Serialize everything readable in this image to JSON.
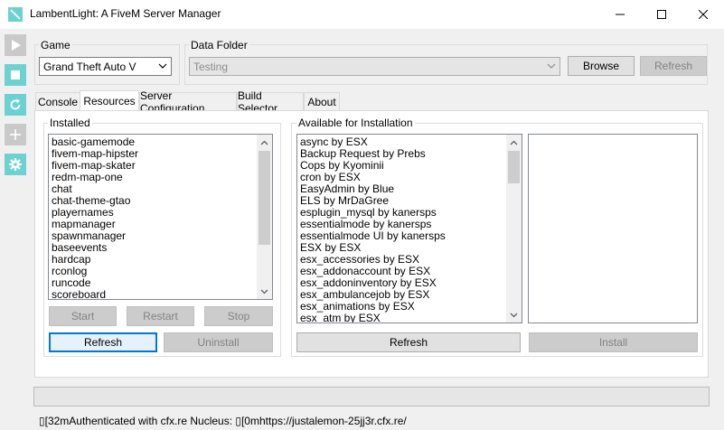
{
  "window": {
    "title": "LambentLight: A FiveM Server Manager",
    "accent": "#6ed1d1"
  },
  "game": {
    "label": "Game",
    "selected": "Grand Theft Auto V"
  },
  "data_folder": {
    "label": "Data Folder",
    "selected": "Testing",
    "browse_label": "Browse",
    "refresh_label": "Refresh"
  },
  "tabs": [
    {
      "label": "Console"
    },
    {
      "label": "Resources"
    },
    {
      "label": "Server Configuration"
    },
    {
      "label": "Build Selector"
    },
    {
      "label": "About"
    }
  ],
  "installed": {
    "label": "Installed",
    "items": [
      "basic-gamemode",
      "fivem-map-hipster",
      "fivem-map-skater",
      "redm-map-one",
      "chat",
      "chat-theme-gtao",
      "playernames",
      "mapmanager",
      "spawnmanager",
      "baseevents",
      "hardcap",
      "rconlog",
      "runcode",
      "scoreboard"
    ],
    "start_label": "Start",
    "restart_label": "Restart",
    "stop_label": "Stop",
    "refresh_label": "Refresh",
    "uninstall_label": "Uninstall"
  },
  "available": {
    "label": "Available for Installation",
    "items": [
      "async by ESX",
      "Backup Request by Prebs",
      "Cops by Kyominii",
      "cron by ESX",
      "EasyAdmin by Blue",
      "ELS by MrDaGree",
      "esplugin_mysql by kanersps",
      "essentialmode by kanersps",
      "essentialmode UI by kanersps",
      "ESX by ESX",
      "esx_accessories by ESX",
      "esx_addonaccount by ESX",
      "esx_addoninventory by ESX",
      "esx_ambulancejob by ESX",
      "esx_animations by ESX",
      "esx_atm by ESX"
    ],
    "refresh_label": "Refresh",
    "install_label": "Install"
  },
  "status": {
    "text": "▯[32mAuthenticated with cfx.re Nucleus: ▯[0mhttps://justalemon-25jj3r.cfx.re/"
  },
  "sidebar_icons": [
    "play-icon",
    "stop-icon",
    "restart-icon",
    "add-icon",
    "gear-icon"
  ]
}
